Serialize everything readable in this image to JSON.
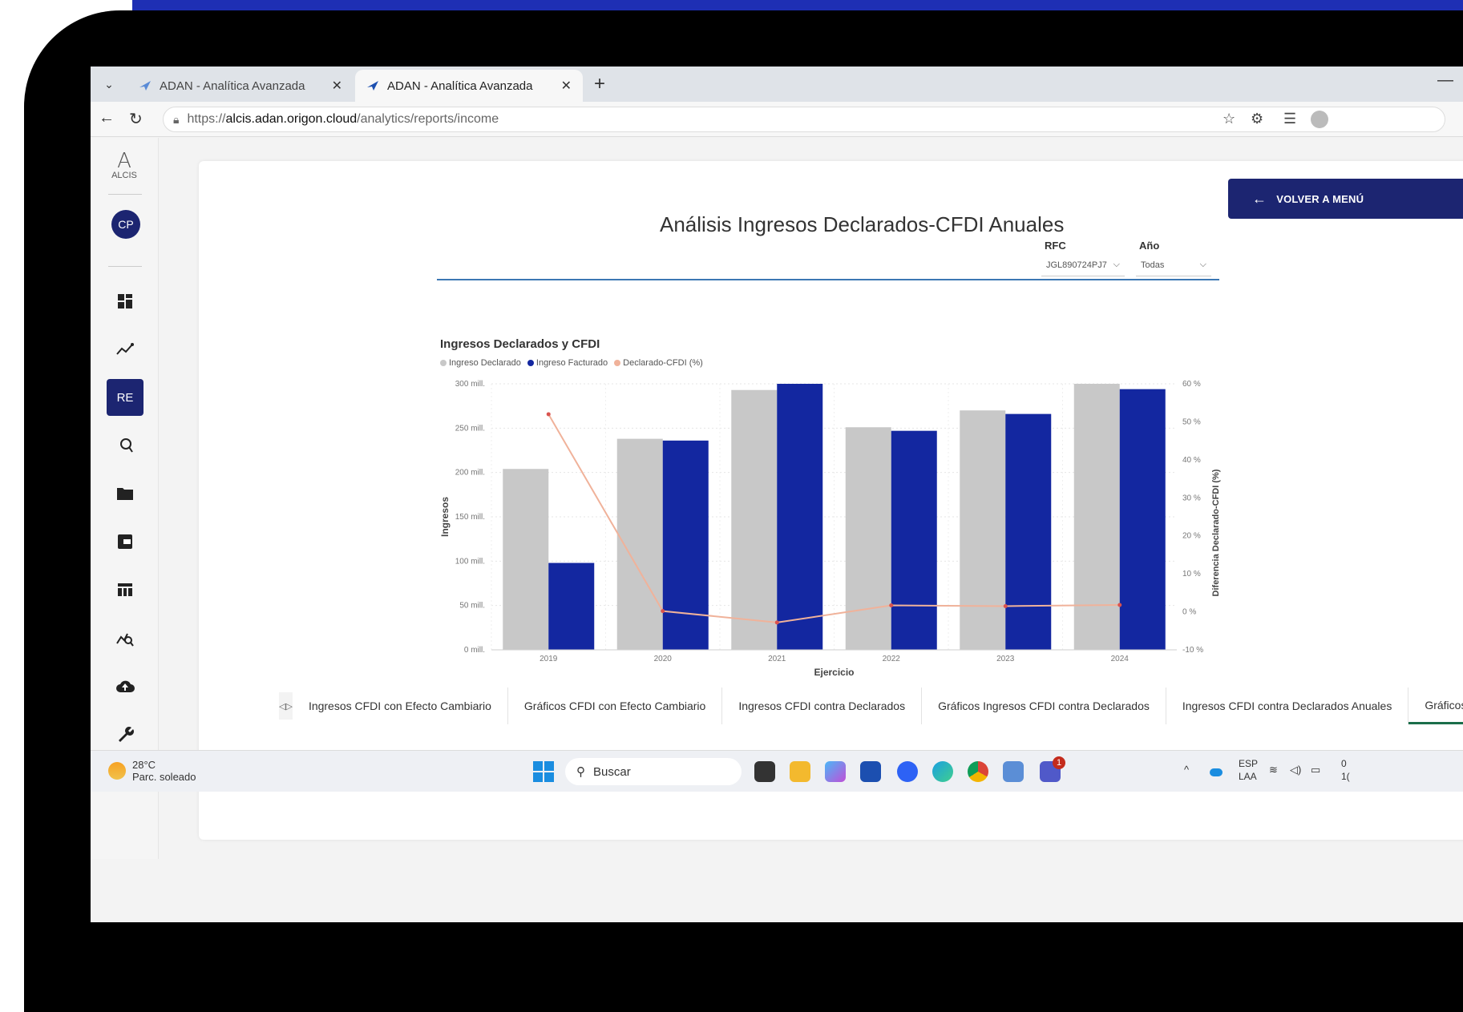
{
  "browser": {
    "tabs": [
      {
        "title": "ADAN - Analítica Avanzada",
        "active": false
      },
      {
        "title": "ADAN - Analítica Avanzada",
        "active": true
      }
    ],
    "url_prefix": "https://",
    "url_host": "alcis.adan.origon.cloud",
    "url_path": "/analytics/reports/income"
  },
  "sidebar": {
    "logo_mark": "A",
    "logo_text": "ALCIS",
    "avatar": "CP",
    "active_item": "RE",
    "icons": [
      "dashboard-icon",
      "analytics-icon",
      "report-icon",
      "search-icon",
      "folder-icon",
      "wallet-icon",
      "table-icon",
      "chart-search-icon",
      "cloud-upload-icon",
      "wrench-icon"
    ]
  },
  "header": {
    "back_button": "VOLVER A MENÚ"
  },
  "report": {
    "title": "Análisis Ingresos Declarados-CFDI Anuales",
    "filters": {
      "rfc_label": "RFC",
      "rfc_value": "JGL890724PJ7",
      "year_label": "Año",
      "year_value": "Todas"
    }
  },
  "chart_data": {
    "type": "bar",
    "title": "Ingresos Declarados y CFDI",
    "categories": [
      "2019",
      "2020",
      "2021",
      "2022",
      "2023",
      "2024"
    ],
    "series": [
      {
        "name": "Ingreso Declarado",
        "type": "bar",
        "color": "#c8c8c8",
        "values": [
          204,
          238,
          293,
          251,
          270,
          300
        ]
      },
      {
        "name": "Ingreso Facturado",
        "type": "bar",
        "color": "#1327a0",
        "values": [
          98,
          236,
          300,
          247,
          266,
          294
        ]
      },
      {
        "name": "Declarado-CFDI (%)",
        "type": "line",
        "axis": "right",
        "color": "#f0b29a",
        "values": [
          52,
          0.2,
          -2.8,
          1.7,
          1.5,
          1.8
        ]
      }
    ],
    "xlabel": "Ejercicio",
    "ylabel": "Ingresos",
    "y2label": "Diferencia Declarado-CFDI (%)",
    "ylim": [
      0,
      300
    ],
    "y2lim": [
      -10,
      60
    ],
    "yticks": [
      "0 mill.",
      "50 mill.",
      "100 mill.",
      "150 mill.",
      "200 mill.",
      "250 mill.",
      "300 mill."
    ],
    "y2ticks": [
      "-10 %",
      "0 %",
      "10 %",
      "20 %",
      "30 %",
      "40 %",
      "50 %",
      "60 %"
    ],
    "grid": true,
    "legend_position": "top-left"
  },
  "page_tabs": [
    {
      "label": "Ingresos CFDI con Efecto Cambiario",
      "active": false
    },
    {
      "label": "Gráficos CFDI con Efecto Cambiario",
      "active": false
    },
    {
      "label": "Ingresos CFDI contra Declarados",
      "active": false
    },
    {
      "label": "Gráficos Ingresos CFDI contra Declarados",
      "active": false
    },
    {
      "label": "Ingresos CFDI contra Declarados Anuales",
      "active": false
    },
    {
      "label": "Gráficos In",
      "active": true
    }
  ],
  "taskbar": {
    "temperature": "28°C",
    "weather": "Parc. soleado",
    "search_placeholder": "Buscar",
    "lang_top": "ESP",
    "lang_bottom": "LAA",
    "badge": "1",
    "clock_top": "0",
    "clock_bottom": "1("
  }
}
